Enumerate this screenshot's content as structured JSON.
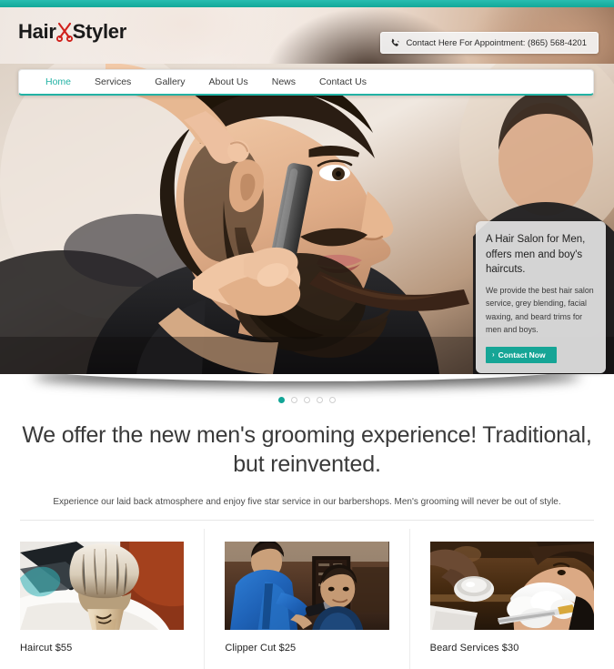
{
  "site": {
    "logo_primary": "Hair",
    "logo_secondary": "Styler",
    "logo_icon": "scissors-icon",
    "accent_color": "#22b2a4",
    "button_color": "#16a596"
  },
  "header": {
    "phone_icon": "phone-icon",
    "contact_text": "Contact Here For Appointment: (865) 568-4201"
  },
  "nav": {
    "items": [
      {
        "label": "Home",
        "active": true
      },
      {
        "label": "Services",
        "active": false
      },
      {
        "label": "Gallery",
        "active": false
      },
      {
        "label": "About Us",
        "active": false
      },
      {
        "label": "News",
        "active": false
      },
      {
        "label": "Contact Us",
        "active": false
      }
    ]
  },
  "hero": {
    "image_alt": "barber shaving a bearded man with a straight razor",
    "caption": {
      "heading": "A Hair Salon for Men, offers men and boy's haircuts.",
      "body": "We provide the best hair salon service, grey blending, facial waxing, and beard trims for men and boys.",
      "button_label": "Contact Now",
      "button_chevron": "chevron-right-icon"
    },
    "slider_dots": [
      {
        "active": true
      },
      {
        "active": false
      },
      {
        "active": false
      },
      {
        "active": false
      },
      {
        "active": false
      }
    ]
  },
  "intro": {
    "heading": "We offer the new men's grooming experience! Traditional, but reinvented.",
    "lede": "Experience our laid back atmosphere and enjoy five star service in our barbershops. Men's grooming will never be out of style."
  },
  "services": {
    "cards": [
      {
        "title": "Haircut $55",
        "image_alt": "shaving brush on white towel"
      },
      {
        "title": "Clipper Cut $25",
        "image_alt": "barber in blue shirt using clippers on client"
      },
      {
        "title": "Beard Services $30",
        "image_alt": "man reclined with shaving cream on face"
      }
    ]
  }
}
